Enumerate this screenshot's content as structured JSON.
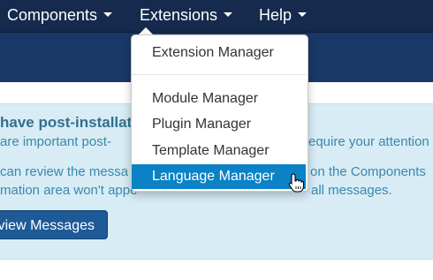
{
  "navbar": {
    "items": [
      {
        "label": "Components"
      },
      {
        "label": "Extensions"
      },
      {
        "label": "Help"
      }
    ]
  },
  "dropdown": {
    "items": [
      {
        "label": "Extension Manager"
      },
      {
        "label": "Module Manager"
      },
      {
        "label": "Plugin Manager"
      },
      {
        "label": "Template Manager"
      },
      {
        "label": "Language Manager"
      }
    ],
    "active_index": 4
  },
  "alert": {
    "heading": "have post-installat",
    "line1_left": "are important post-",
    "line1_right": "equire your attention",
    "line2_left": "can review the messa",
    "line2_right": "on the Components",
    "line3_left": "mation area won't appe",
    "line3_right": "all messages.",
    "button_label": "view Messages"
  },
  "colors": {
    "navbar": "#162a4d",
    "subheader": "#1a3867",
    "alert_bg": "#d8ecf5",
    "active_item": "#0a82c5",
    "button": "#1e5a96"
  },
  "icons": {
    "caret": "chevron-down-icon",
    "pointer": "hand-pointer-icon"
  }
}
